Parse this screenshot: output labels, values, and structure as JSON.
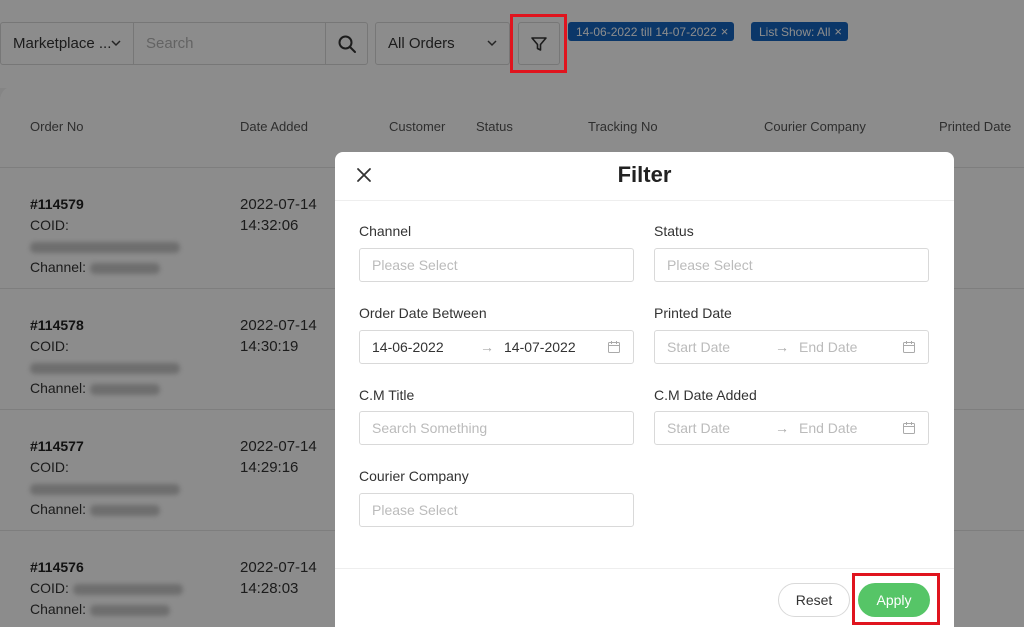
{
  "toolbar": {
    "marketplace_value": "Marketplace ...",
    "search_placeholder": "Search",
    "orders_value": "All Orders",
    "tags": [
      {
        "label": "14-06-2022 till 14-07-2022",
        "close": "×"
      },
      {
        "label": "List Show: All",
        "close": "×"
      }
    ]
  },
  "table": {
    "headers": [
      "Order No",
      "Date Added",
      "Customer",
      "Status",
      "Tracking No",
      "Courier Company",
      "Printed Date"
    ],
    "coid_label": "COID:",
    "channel_label": "Channel:",
    "rows": [
      {
        "order_no": "#114579",
        "date": "2022-07-14",
        "time": "14:32:06"
      },
      {
        "order_no": "#114578",
        "date": "2022-07-14",
        "time": "14:30:19"
      },
      {
        "order_no": "#114577",
        "date": "2022-07-14",
        "time": "14:29:16"
      },
      {
        "order_no": "#114576",
        "date": "2022-07-14",
        "time": "14:28:03"
      }
    ]
  },
  "modal": {
    "title": "Filter",
    "channel": {
      "label": "Channel",
      "placeholder": "Please Select"
    },
    "status": {
      "label": "Status",
      "placeholder": "Please Select"
    },
    "order_date": {
      "label": "Order Date Between",
      "start": "14-06-2022",
      "end": "14-07-2022"
    },
    "printed_date": {
      "label": "Printed Date",
      "start": "Start Date",
      "end": "End Date"
    },
    "cm_title": {
      "label": "C.M Title",
      "placeholder": "Search Something"
    },
    "cm_date_added": {
      "label": "C.M Date Added",
      "start": "Start Date",
      "end": "End Date"
    },
    "courier_company": {
      "label": "Courier Company",
      "placeholder": "Please Select"
    },
    "arrow": "→",
    "reset_label": "Reset",
    "apply_label": "Apply"
  },
  "colors": {
    "tag_bg": "#1565c0",
    "apply_bg": "#56c567",
    "highlight": "#e0141e"
  },
  "icons": [
    "chevron-down-icon",
    "search-icon",
    "filter-icon",
    "close-icon",
    "calendar-icon"
  ]
}
